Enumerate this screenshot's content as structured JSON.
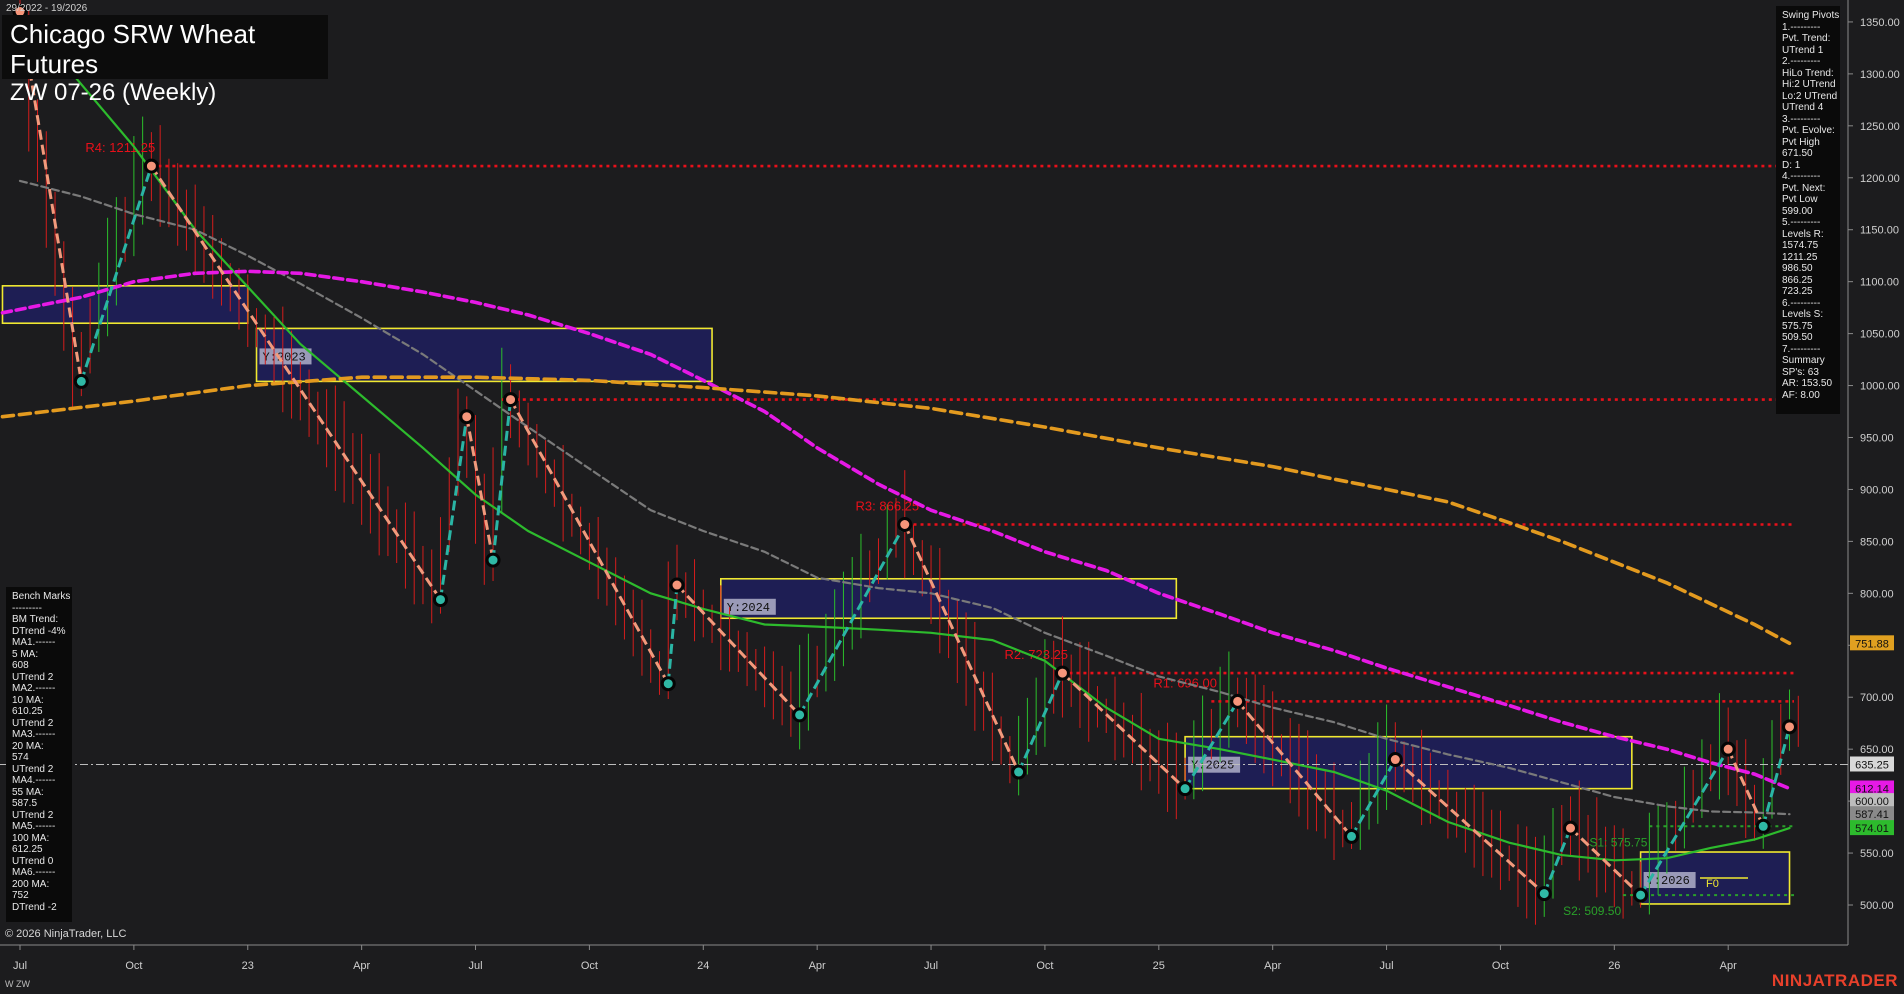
{
  "window": {
    "date_range": "29/2022 - 19/2026",
    "title_line1": "Chicago SRW Wheat Futures",
    "title_line2": "ZW 07-26 (Weekly)",
    "copyright": "© 2026 NinjaTrader, LLC",
    "instrument_tag": "W ZW",
    "brand": "NINJATRADER"
  },
  "swing_pivots_panel": [
    "Swing Pivots",
    "1.---------",
    "Pvt. Trend:",
    "UTrend 1",
    "2.---------",
    "HiLo Trend:",
    "Hi:2 UTrend",
    "Lo:2 UTrend",
    "UTrend 4",
    "3.---------",
    "Pvt. Evolve:",
    "Pvt High",
    "671.50",
    "D: 1",
    "4.---------",
    "Pvt. Next:",
    "Pvt Low",
    "599.00",
    "5.---------",
    "Levels R:",
    "1574.75",
    "1211.25",
    "986.50",
    "866.25",
    "723.25",
    "6.---------",
    "Levels S:",
    "575.75",
    "509.50",
    "7.---------",
    "Summary",
    "SP's: 63",
    "AR: 153.50",
    "AF: 8.00"
  ],
  "bench_marks_panel": [
    "Bench Marks",
    "---------",
    "BM Trend:",
    "DTrend -4%",
    "MA1.------",
    "5 MA:",
    "608",
    "UTrend 2",
    "MA2.------",
    "10 MA:",
    "610.25",
    "UTrend 2",
    "MA3.------",
    "20 MA:",
    "574",
    "UTrend 2",
    "MA4.------",
    "55 MA:",
    "587.5",
    "UTrend 2",
    "MA5.------",
    "100 MA:",
    "612.25",
    "UTrend 0",
    "MA6.------",
    "200 MA:",
    "752",
    "DTrend -2"
  ],
  "colors": {
    "background": "#1c1c1e",
    "resistance": "#e8101a",
    "support": "#2aa02a",
    "pivot_up": "#2ab5a5",
    "pivot_down": "#f29a7c",
    "ma_green": "#2dbb2d",
    "ma_magenta": "#e619e6",
    "ma_gray": "#707070",
    "ma_orange": "#e39a1f",
    "box_border": "#f0e830",
    "box_fill": "#1e1e5e"
  },
  "chart_data": {
    "type": "line",
    "title": "Chicago SRW Wheat Futures ZW 07-26 (Weekly)",
    "x_tick_labels": [
      "Jul",
      "Oct",
      "23",
      "Apr",
      "Jul",
      "Oct",
      "24",
      "Apr",
      "Jul",
      "Oct",
      "25",
      "Apr",
      "Jul",
      "Oct",
      "26",
      "Apr"
    ],
    "x_tick_index": [
      0,
      13,
      26,
      39,
      52,
      65,
      78,
      91,
      104,
      117,
      130,
      143,
      156,
      169,
      182,
      195
    ],
    "y_ticks": [
      500,
      550,
      600,
      650,
      700,
      750,
      800,
      850,
      900,
      950,
      1000,
      1050,
      1100,
      1150,
      1200,
      1250,
      1300,
      1350
    ],
    "ylim": [
      470,
      1380
    ],
    "xlim": [
      -2,
      208
    ],
    "price_markers": [
      {
        "label": "751.88",
        "value": 751.88,
        "color": "#e0a020"
      },
      {
        "label": "635.25",
        "value": 635.25,
        "color": "#d8d8d8"
      },
      {
        "label": "612.14",
        "value": 612.14,
        "color": "#e619e6"
      },
      {
        "label": "600.00",
        "value": 600.0,
        "color": "#bdbdbd"
      },
      {
        "label": "587.41",
        "value": 587.41,
        "color": "#8a8a8a"
      },
      {
        "label": "574.01",
        "value": 574.01,
        "color": "#2dbb2d"
      }
    ],
    "resistance_levels": [
      {
        "label": "R4: 1211.25",
        "value": 1211.25,
        "start": 15
      },
      {
        "label": "",
        "value": 986.5,
        "start": 55
      },
      {
        "label": "R3: 866.25",
        "value": 866.25,
        "start": 102
      },
      {
        "label": "R2: 723.25",
        "value": 723.25,
        "start": 119
      },
      {
        "label": "R1: 696.00",
        "value": 696.0,
        "start": 136
      }
    ],
    "support_levels": [
      {
        "label": "S1: 575.75",
        "value": 575.75,
        "start": 186
      },
      {
        "label": "S2: 509.50",
        "value": 509.5,
        "start": 183
      }
    ],
    "current_price": 635.25,
    "swing_pivots": [
      {
        "x": 0,
        "y": 1360,
        "type": "high"
      },
      {
        "x": 7,
        "y": 1004,
        "type": "low"
      },
      {
        "x": 15,
        "y": 1211.25,
        "type": "high"
      },
      {
        "x": 48,
        "y": 794,
        "type": "low"
      },
      {
        "x": 51,
        "y": 970,
        "type": "high"
      },
      {
        "x": 54,
        "y": 832,
        "type": "low"
      },
      {
        "x": 56,
        "y": 986.5,
        "type": "high"
      },
      {
        "x": 74,
        "y": 713,
        "type": "low"
      },
      {
        "x": 75,
        "y": 808,
        "type": "high"
      },
      {
        "x": 89,
        "y": 683,
        "type": "low"
      },
      {
        "x": 101,
        "y": 866.25,
        "type": "high"
      },
      {
        "x": 114,
        "y": 628,
        "type": "low"
      },
      {
        "x": 119,
        "y": 723.25,
        "type": "high"
      },
      {
        "x": 133,
        "y": 612,
        "type": "low"
      },
      {
        "x": 139,
        "y": 696,
        "type": "high"
      },
      {
        "x": 152,
        "y": 566,
        "type": "low"
      },
      {
        "x": 157,
        "y": 640,
        "type": "high"
      },
      {
        "x": 174,
        "y": 511,
        "type": "low"
      },
      {
        "x": 177,
        "y": 574,
        "type": "high"
      },
      {
        "x": 185,
        "y": 509.5,
        "type": "low"
      },
      {
        "x": 195,
        "y": 650,
        "type": "high"
      },
      {
        "x": 199,
        "y": 575.75,
        "type": "low"
      },
      {
        "x": 202,
        "y": 671.5,
        "type": "high"
      }
    ],
    "year_boxes": [
      {
        "label": "Y:2022",
        "x0": -2,
        "x1": 26,
        "y0": 1060,
        "y1": 1096,
        "show_label": false
      },
      {
        "label": "Y:2023",
        "x0": 27,
        "x1": 79,
        "y0": 1004,
        "y1": 1055
      },
      {
        "label": "Y:2024",
        "x0": 80,
        "x1": 132,
        "y0": 776,
        "y1": 814
      },
      {
        "label": "Y:2025",
        "x0": 133,
        "x1": 184,
        "y0": 612,
        "y1": 662
      },
      {
        "label": "Y:2026",
        "x0": 185,
        "x1": 202,
        "y0": 501,
        "y1": 551
      }
    ],
    "moving_averages": [
      {
        "name": "20 MA",
        "color": "#2dbb2d",
        "dash": "",
        "width": 2.2,
        "points": [
          [
            0,
            1360
          ],
          [
            7,
            1290
          ],
          [
            13,
            1230
          ],
          [
            20,
            1150
          ],
          [
            26,
            1095
          ],
          [
            32,
            1040
          ],
          [
            39,
            990
          ],
          [
            46,
            940
          ],
          [
            52,
            895
          ],
          [
            58,
            860
          ],
          [
            65,
            830
          ],
          [
            72,
            800
          ],
          [
            78,
            785
          ],
          [
            85,
            770
          ],
          [
            91,
            768
          ],
          [
            98,
            765
          ],
          [
            104,
            762
          ],
          [
            111,
            755
          ],
          [
            117,
            735
          ],
          [
            124,
            690
          ],
          [
            130,
            660
          ],
          [
            137,
            650
          ],
          [
            143,
            640
          ],
          [
            150,
            628
          ],
          [
            156,
            610
          ],
          [
            163,
            580
          ],
          [
            170,
            560
          ],
          [
            176,
            548
          ],
          [
            182,
            543
          ],
          [
            188,
            545
          ],
          [
            193,
            555
          ],
          [
            198,
            563
          ],
          [
            202,
            574
          ]
        ]
      },
      {
        "name": "55 MA",
        "color": "#7a7a7a",
        "dash": "7,4",
        "width": 2.2,
        "points": [
          [
            0,
            1197
          ],
          [
            7,
            1182
          ],
          [
            13,
            1165
          ],
          [
            20,
            1150
          ],
          [
            26,
            1125
          ],
          [
            32,
            1098
          ],
          [
            39,
            1065
          ],
          [
            46,
            1030
          ],
          [
            52,
            995
          ],
          [
            58,
            960
          ],
          [
            65,
            920
          ],
          [
            72,
            880
          ],
          [
            78,
            860
          ],
          [
            85,
            840
          ],
          [
            91,
            815
          ],
          [
            98,
            805
          ],
          [
            104,
            800
          ],
          [
            111,
            786
          ],
          [
            117,
            762
          ],
          [
            124,
            740
          ],
          [
            130,
            720
          ],
          [
            137,
            705
          ],
          [
            143,
            690
          ],
          [
            150,
            676
          ],
          [
            156,
            660
          ],
          [
            163,
            645
          ],
          [
            170,
            632
          ],
          [
            176,
            618
          ],
          [
            182,
            604
          ],
          [
            188,
            595
          ],
          [
            193,
            590
          ],
          [
            198,
            589
          ],
          [
            202,
            587.41
          ]
        ]
      },
      {
        "name": "100 MA",
        "color": "#e619e6",
        "dash": "9,5",
        "width": 3.6,
        "points": [
          [
            -2,
            1070
          ],
          [
            7,
            1085
          ],
          [
            13,
            1100
          ],
          [
            20,
            1108
          ],
          [
            26,
            1110
          ],
          [
            32,
            1108
          ],
          [
            39,
            1100
          ],
          [
            46,
            1090
          ],
          [
            52,
            1080
          ],
          [
            58,
            1068
          ],
          [
            65,
            1050
          ],
          [
            72,
            1030
          ],
          [
            78,
            1005
          ],
          [
            85,
            975
          ],
          [
            91,
            940
          ],
          [
            98,
            905
          ],
          [
            104,
            880
          ],
          [
            111,
            860
          ],
          [
            117,
            840
          ],
          [
            124,
            822
          ],
          [
            130,
            800
          ],
          [
            137,
            780
          ],
          [
            143,
            762
          ],
          [
            150,
            745
          ],
          [
            156,
            728
          ],
          [
            163,
            710
          ],
          [
            170,
            692
          ],
          [
            176,
            676
          ],
          [
            182,
            662
          ],
          [
            188,
            650
          ],
          [
            193,
            637
          ],
          [
            198,
            626
          ],
          [
            202,
            612.14
          ]
        ]
      },
      {
        "name": "200 MA",
        "color": "#e39a1f",
        "dash": "11,6",
        "width": 3.6,
        "points": [
          [
            -2,
            970
          ],
          [
            13,
            985
          ],
          [
            26,
            1000
          ],
          [
            39,
            1008
          ],
          [
            52,
            1008
          ],
          [
            65,
            1005
          ],
          [
            78,
            998
          ],
          [
            91,
            990
          ],
          [
            104,
            978
          ],
          [
            117,
            960
          ],
          [
            130,
            940
          ],
          [
            143,
            922
          ],
          [
            150,
            910
          ],
          [
            156,
            900
          ],
          [
            163,
            888
          ],
          [
            170,
            868
          ],
          [
            176,
            850
          ],
          [
            182,
            830
          ],
          [
            188,
            810
          ],
          [
            193,
            790
          ],
          [
            198,
            770
          ],
          [
            202,
            751.88
          ]
        ]
      }
    ]
  }
}
